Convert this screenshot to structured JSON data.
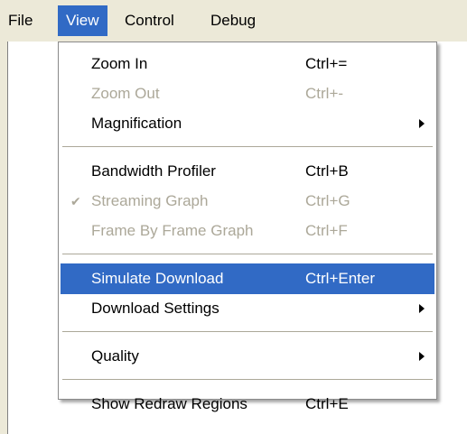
{
  "menubar": {
    "items": [
      {
        "label": "File"
      },
      {
        "label": "View"
      },
      {
        "label": "Control"
      },
      {
        "label": "Debug"
      }
    ]
  },
  "view_menu": {
    "items": [
      {
        "label": "Zoom In",
        "shortcut": "Ctrl+="
      },
      {
        "label": "Zoom Out",
        "shortcut": "Ctrl+-"
      },
      {
        "label": "Magnification"
      },
      {
        "label": "Bandwidth Profiler",
        "shortcut": "Ctrl+B"
      },
      {
        "label": "Streaming Graph",
        "shortcut": "Ctrl+G",
        "check": "✔"
      },
      {
        "label": "Frame By Frame Graph",
        "shortcut": "Ctrl+F"
      },
      {
        "label": "Simulate Download",
        "shortcut": "Ctrl+Enter"
      },
      {
        "label": "Download Settings"
      },
      {
        "label": "Quality"
      },
      {
        "label": "Show Redraw Regions",
        "shortcut": "Ctrl+E"
      }
    ]
  },
  "colors": {
    "menubar_bg": "#ece9d8",
    "highlight": "#316ac5",
    "disabled_text": "#aca899"
  }
}
